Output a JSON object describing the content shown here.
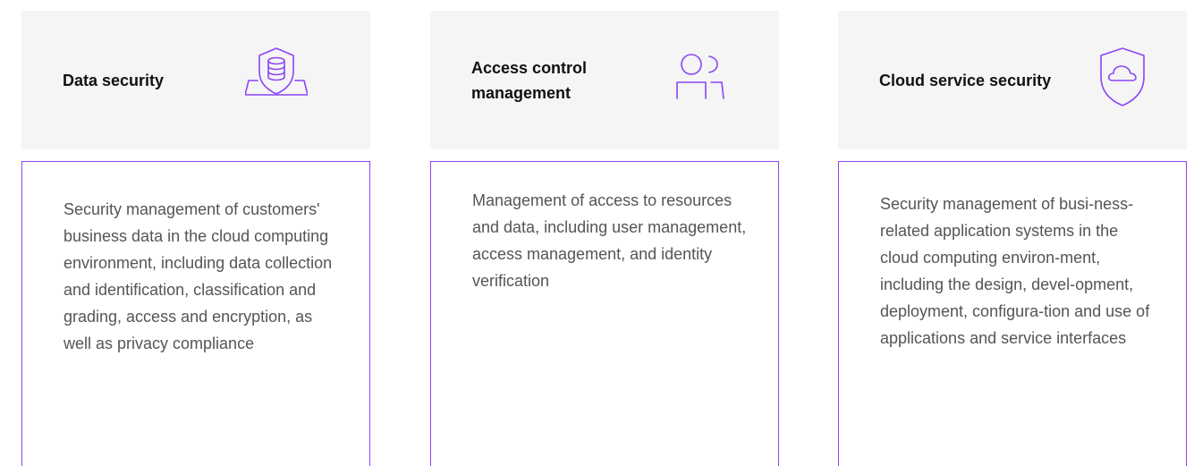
{
  "cards": [
    {
      "title": "Data security",
      "icon": "database-shield-icon",
      "description": "Security management of customers' business data in the cloud computing environment, including data collection and identification, classification and grading, access and encryption, as well as privacy compliance"
    },
    {
      "title": "Access control management",
      "icon": "users-icon",
      "description": "Management of access to resources and data, including user management, access management, and identity verification"
    },
    {
      "title": "Cloud service security",
      "icon": "cloud-shield-icon",
      "description": "Security management of busi-ness-related application systems in the cloud computing environ-ment, including the design, devel-opment, deployment, configura-tion and use of applications and service interfaces"
    }
  ],
  "colors": {
    "accent": "#8b45f5",
    "header_bg": "#f5f5f5",
    "title_text": "#111111",
    "body_text": "#555555"
  }
}
